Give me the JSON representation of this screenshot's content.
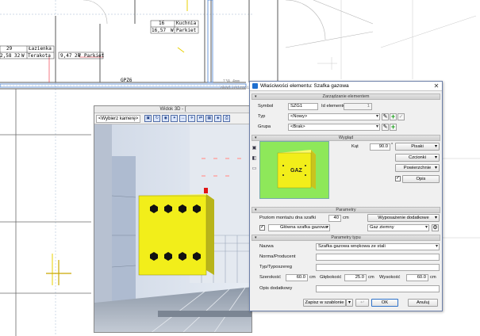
{
  "cad": {
    "room_a": {
      "num": "29",
      "name": "Łazienka",
      "area": "2,58 32",
      "floor_tag": "W",
      "floor": "Terakota"
    },
    "room_b": {
      "num": "16",
      "name": "Kuchnia",
      "area": "16,57",
      "floor_tag": "W",
      "floor": "Parkiet"
    },
    "room_c": {
      "area": "9,47 27",
      "floor_tag": "W",
      "floor": "Parkiet"
    },
    "tag_gpz": "GPZ6",
    "note_1": "13A 4mm",
    "note_2": "okad uslenni"
  },
  "view3d": {
    "title": "Widok 3D - [",
    "camera": "<Wybierz kamerę>",
    "toolbar_icons": [
      "cube-icon",
      "rotate-icon",
      "camera-icon",
      "walk-icon",
      "arrow-icon",
      "plane-icon",
      "arrows-icon",
      "grid-icon",
      "render-icon",
      "print-icon"
    ]
  },
  "dialog": {
    "title": "Właściwości elementu: Szafka gazowa",
    "close": "✕",
    "sections": {
      "management": "Zarządzanie elementem",
      "appearance": "Wygląd",
      "parameters": "Parametry",
      "type_parameters": "Parametry typu"
    },
    "symbol_label": "Symbol",
    "symbol_value": "SZG1",
    "id_label": "Id elementu",
    "id_value": "1",
    "type_label": "Typ",
    "type_value": "<Nowy>",
    "group_label": "Grupa",
    "group_value": "<Brak>",
    "angle_label": "Kąt",
    "angle_value": "90.0",
    "angle_unit": "°",
    "btn_pens": "Pisaki",
    "btn_fonts": "Czcionki",
    "btn_surfaces": "Powierzchnie",
    "btn_description": "Opis",
    "preview_text": "GAZ",
    "mount_label": "Poziom montażu dna szafki",
    "mount_value": "40",
    "mount_unit": "cm",
    "extra_equipment": "Wyposażenie dodatkowe",
    "main_cabinet": "Główna szafka gazowa",
    "gas_type": "Gaz ziemny",
    "name_label": "Nazwa",
    "name_value": "Szafka gazowa wnękowa ze stali",
    "producer_label": "Norma/Producent",
    "type_series_label": "Typ/Typoszereg",
    "width_label": "Szerokość",
    "width_value": "60.0",
    "width_unit": "cm",
    "depth_label": "Głębokość",
    "depth_value": "25.0",
    "depth_unit": "cm",
    "height_label": "Wysokość",
    "height_value": "60.0",
    "height_unit": "cm",
    "extra_desc_label": "Opis dodatkowy",
    "save_template": "Zapisz w szablonie",
    "ok": "OK",
    "cancel": "Anuluj",
    "colors": {
      "accent": "#2f72c9",
      "cabinet": "#f2ee1a",
      "preview_bg": "#8ee85a"
    }
  }
}
